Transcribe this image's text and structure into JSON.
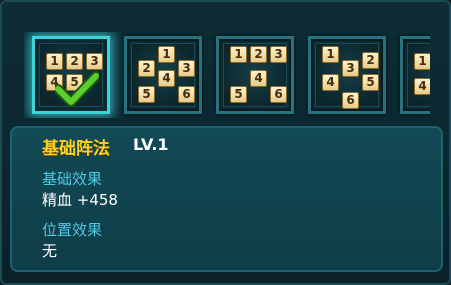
{
  "formations": [
    {
      "tiles": [
        "1",
        "2",
        "3",
        "4",
        "5"
      ],
      "selected": true
    },
    {
      "tiles": [
        "1",
        "2",
        "3",
        "4",
        "5",
        "6"
      ],
      "selected": false
    },
    {
      "tiles": [
        "1",
        "2",
        "3",
        "4",
        "5",
        "6"
      ],
      "selected": false
    },
    {
      "tiles": [
        "1",
        "2",
        "3",
        "4",
        "5",
        "6"
      ],
      "selected": false
    },
    {
      "tiles": [
        "1",
        "4"
      ],
      "selected": false
    }
  ],
  "panel": {
    "title": "基础阵法",
    "level": "LV.1",
    "base_effect_label": "基础效果",
    "base_effect_value": "精血 +458",
    "position_effect_label": "位置效果",
    "position_effect_value": "无"
  },
  "colors": {
    "title": "#ffd21f",
    "label": "#4fc8e4",
    "selected_glow": "#3fd3dc",
    "check": "#5ccf2e"
  },
  "icons": {
    "selected_marker": "checkmark-icon"
  }
}
